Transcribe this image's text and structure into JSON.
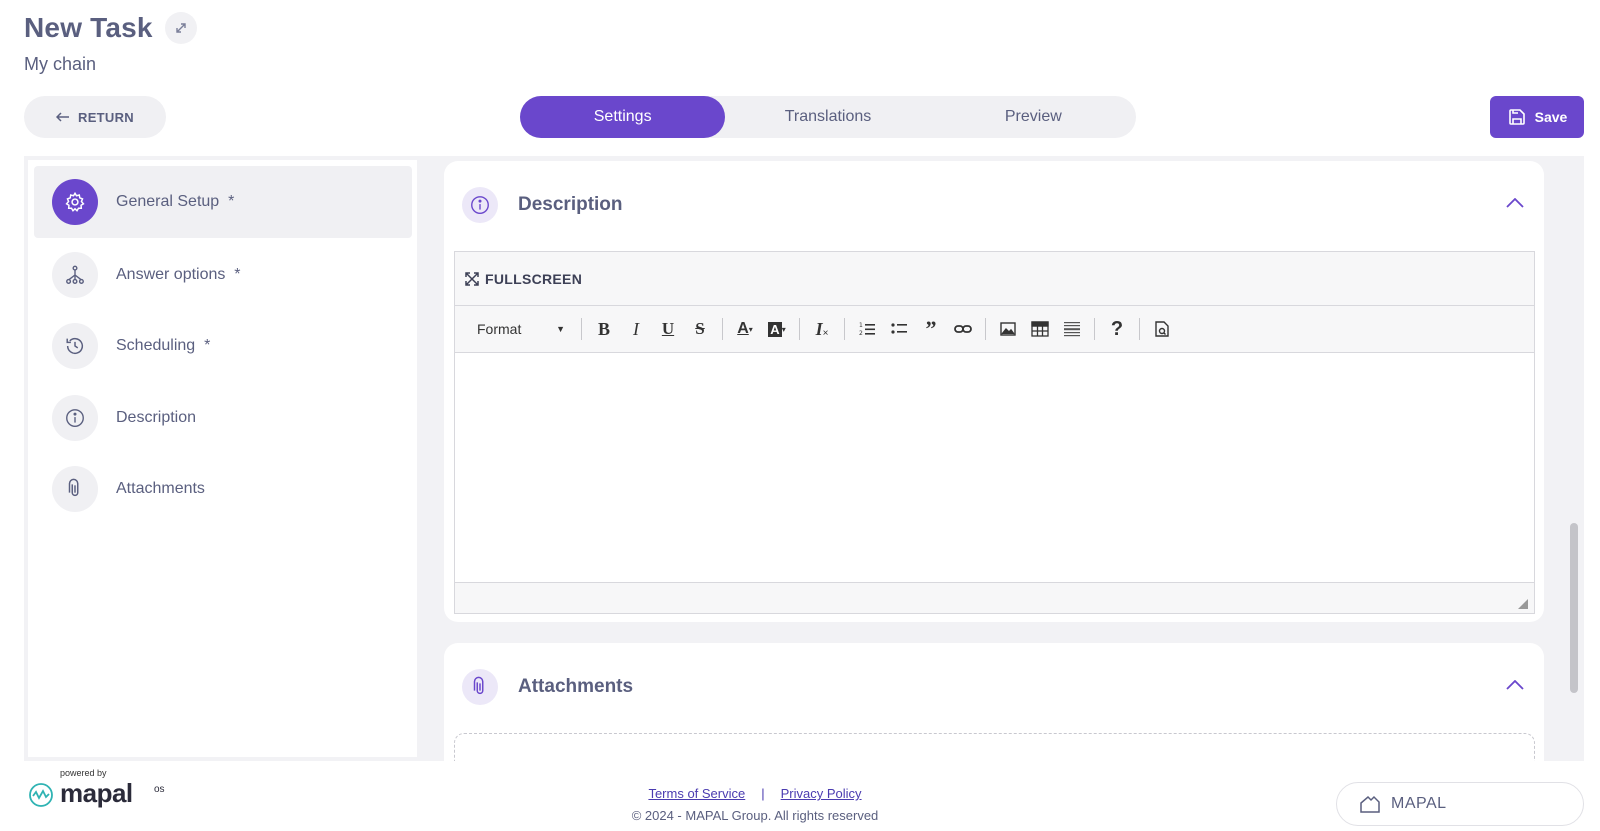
{
  "header": {
    "title": "New Task",
    "subtitle": "My chain"
  },
  "toolbar": {
    "return_label": "RETURN",
    "save_label": "Save"
  },
  "tabs": [
    {
      "label": "Settings",
      "active": true
    },
    {
      "label": "Translations",
      "active": false
    },
    {
      "label": "Preview",
      "active": false
    }
  ],
  "sidebar": {
    "items": [
      {
        "label": "General Setup",
        "required": "*",
        "icon": "gear-icon",
        "active": true
      },
      {
        "label": "Answer options",
        "required": "*",
        "icon": "hierarchy-icon",
        "active": false
      },
      {
        "label": "Scheduling",
        "required": "*",
        "icon": "history-icon",
        "active": false
      },
      {
        "label": "Description",
        "required": "",
        "icon": "info-icon",
        "active": false
      },
      {
        "label": "Attachments",
        "required": "",
        "icon": "paperclip-icon",
        "active": false
      }
    ]
  },
  "description_card": {
    "title": "Description",
    "icon": "info-icon",
    "editor": {
      "fullscreen_label": "FULLSCREEN",
      "format_label": "Format",
      "buttons": [
        "bold",
        "italic",
        "underline",
        "strikethrough",
        "text-color",
        "background-color",
        "remove-format",
        "numbered-list",
        "bulleted-list",
        "blockquote",
        "link",
        "image",
        "table",
        "horizontal-line",
        "help",
        "source"
      ],
      "text_color_glyph": "A",
      "bg_color_glyph": "A",
      "clear_glyph": "I"
    }
  },
  "attachments_card": {
    "title": "Attachments",
    "icon": "paperclip-icon"
  },
  "footer": {
    "powered_by": "powered by",
    "logo_text": "mapal",
    "logo_suffix": "os",
    "terms_label": "Terms of Service",
    "separator": "|",
    "privacy_label": "Privacy Policy",
    "copyright": "© 2024 - MAPAL Group. All rights reserved",
    "workspace_label": "MAPAL"
  },
  "colors": {
    "accent": "#6a47cc",
    "text": "#5a5f7f",
    "surface": "#f0f0f3"
  }
}
